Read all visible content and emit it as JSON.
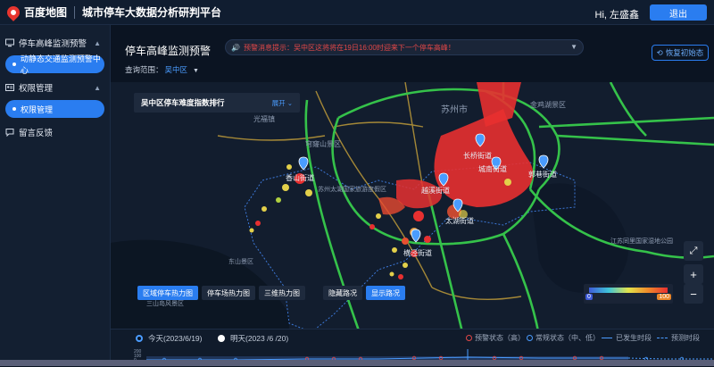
{
  "header": {
    "logo_text": "百度地图",
    "app_title": "城市停车大数据分析研判平台",
    "greeting": "Hi, 左盛鑫",
    "logout_label": "退出"
  },
  "sidebar": {
    "groups": [
      {
        "label": "停车高峰监测预警",
        "sub": "动静态交通监测预警中心"
      },
      {
        "label": "权限管理",
        "sub": "权限管理"
      },
      {
        "label": "留言反馈"
      }
    ]
  },
  "main": {
    "title": "停车高峰监测预警",
    "notice": "预警消息提示：吴中区这将将在19日16:00时迎来下一个停车高峰！",
    "restore_label": "恢复初始态",
    "scope_label": "查询范围：",
    "scope_value": "吴中区"
  },
  "map": {
    "ranking_title": "吴中区停车难度指数排行",
    "ranking_expand": "展开",
    "place_labels": [
      "苏州市",
      "长桥街道",
      "城南街道",
      "郭巷街道",
      "香山街道",
      "横泾街道",
      "太湖街道",
      "越溪街道",
      "光福镇",
      "穹窿山景区",
      "金鸡湖景区",
      "江苏同里国家湿地公园",
      "东山景区",
      "三山岛风景区",
      "苏州太湖国家旅游度假区"
    ],
    "modes": [
      "区域停车热力图",
      "停车场热力图",
      "三维热力图"
    ],
    "road_modes": [
      "隐藏路况",
      "显示路况"
    ],
    "active_mode": "区域停车热力图",
    "active_road_mode": "显示路况",
    "legend_min": "0",
    "legend_max": "100",
    "zoom_in": "+",
    "zoom_out": "−"
  },
  "timeline": {
    "today": "今天(2023/6/19)",
    "tomorrow": "明天(2023 /6 /20)",
    "legend": [
      "预警状态（高）",
      "常规状态（中、低）",
      "已发生时段",
      "预测时段"
    ],
    "y_ticks": [
      "200",
      "100",
      "0"
    ]
  },
  "colors": {
    "accent": "#2a7df0",
    "warn": "#e34848",
    "heat_high": "#e83030"
  }
}
